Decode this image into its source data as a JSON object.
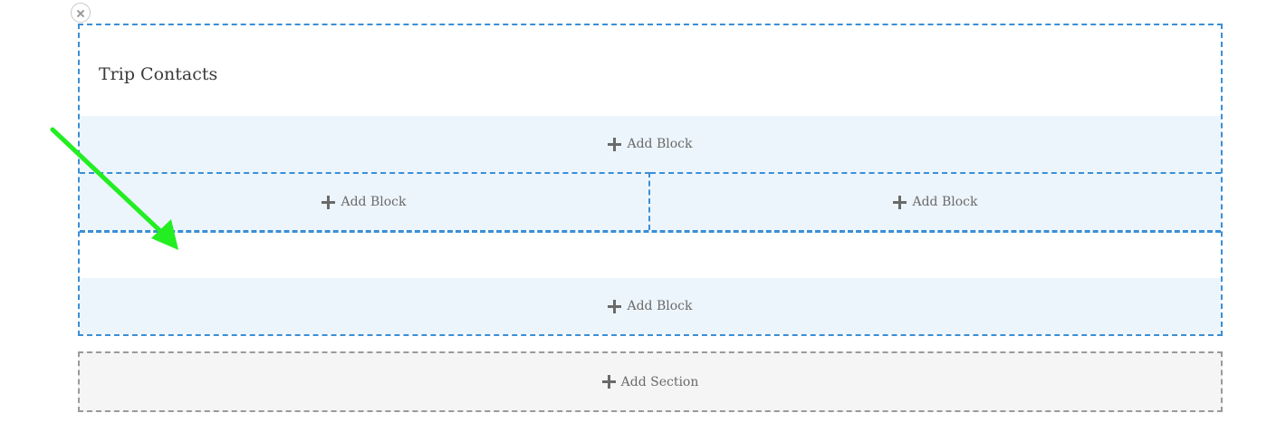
{
  "section": {
    "title": "Trip Contacts",
    "close_icon": "close-icon"
  },
  "blocks": {
    "row1_label": "Add Block",
    "row2_left_label": "Add Block",
    "row2_right_label": "Add Block",
    "row3_label": "Add Block"
  },
  "add_section": {
    "label": "Add Section"
  },
  "annotation": {
    "arrow_icon": "arrow-icon",
    "arrow_color": "#22ee22"
  },
  "colors": {
    "section_border": "#3a8fd6",
    "block_background": "#edf5fc",
    "add_section_border": "#9a9a9a",
    "add_section_background": "#f5f5f5"
  }
}
